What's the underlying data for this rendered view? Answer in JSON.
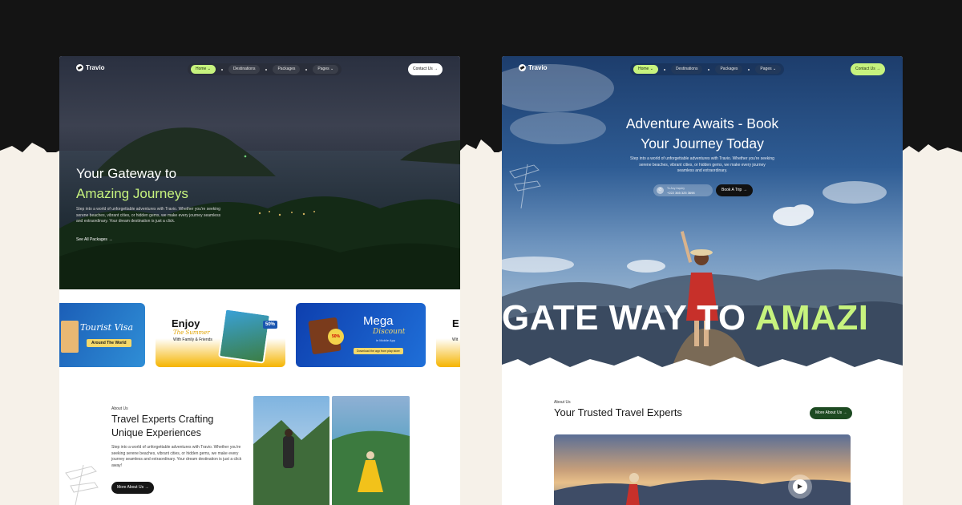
{
  "brand": {
    "name": "Travio"
  },
  "nav": {
    "items": [
      "Home",
      "Destinations",
      "Packages",
      "Pages"
    ],
    "contact_label": "Contact Us"
  },
  "left_mockup": {
    "hero": {
      "title_line1": "Your Gateway to",
      "title_line2": "Amazing Journeys",
      "description": "Step into a world of unforgettable adventures with Travio. Whether you're seeking serene beaches, vibrant cities, or hidden gems, we make every journey seamless and extraordinary. Your dream destination is just a click.",
      "link_label": "See All Packages"
    },
    "promos": [
      {
        "title": "Tourist Visa",
        "subtitle": "Around The World"
      },
      {
        "title": "Enjoy",
        "script": "The Summer",
        "subtitle": "With Family & Friends",
        "badge": "50%"
      },
      {
        "title": "Mega",
        "script": "Discount",
        "subtitle": "in Mobile App",
        "badge": "50%",
        "cta": "Download the app from play store"
      },
      {
        "title": "E",
        "subtitle": "Wit"
      }
    ],
    "about": {
      "label": "About Us",
      "title_line1": "Travel Experts Crafting",
      "title_line2": "Unique Experiences",
      "description": "Step into a world of unforgettable adventures with Travio. Whether you're seeking serene beaches, vibrant cities, or hidden gems, we make every journey seamless and extraordinary. Your dream destination is just a click away!",
      "button_label": "More About Us"
    }
  },
  "right_mockup": {
    "hero": {
      "title_line1": "Adventure Awaits - Book",
      "title_line2": "Your Journey Today",
      "description": "Step into a world of unforgettable adventures with Travio. Whether you're seeking serene beaches, vibrant cities, or hidden gems, we make every journey seamless and extraordinary.",
      "phone_label": "To Any Inquiry",
      "phone_number": "+222 365 325 3698",
      "book_label": "Book A Trip"
    },
    "scroll_text": {
      "part1": "GATE WAY TO ",
      "part2": "AMAZI"
    },
    "about": {
      "label": "About Us",
      "title": "Your Trusted Travel Experts",
      "button_label": "More About Us"
    }
  },
  "colors": {
    "accent": "#c7f37e",
    "dark_band": "#141414",
    "cream": "#f6f1e9",
    "dark_green": "#1d4a22"
  },
  "icons": [
    "travio-logo-icon",
    "chevron-down-icon",
    "arrow-right-icon",
    "phone-icon",
    "play-icon",
    "signpost-icon"
  ]
}
